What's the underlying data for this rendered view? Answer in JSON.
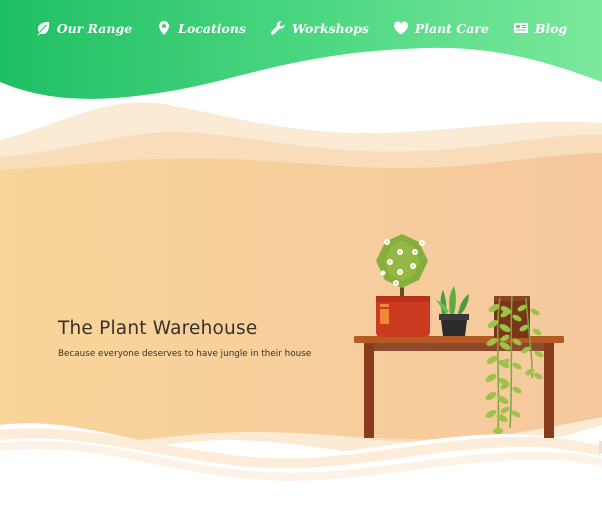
{
  "nav": {
    "items": [
      {
        "label": "Our Range",
        "icon": "leaf-icon"
      },
      {
        "label": "Locations",
        "icon": "map-pin-icon"
      },
      {
        "label": "Workshops",
        "icon": "wrench-icon"
      },
      {
        "label": "Plant Care",
        "icon": "heart-icon"
      },
      {
        "label": "Blog",
        "icon": "newspaper-icon"
      }
    ]
  },
  "hero": {
    "title": "The Plant Warehouse",
    "subtitle": "Because everyone deserves to have jungle in their house"
  },
  "colors": {
    "nav_gradient_start": "#1fbf63",
    "nav_gradient_end": "#7be89c",
    "hero_gradient_start": "#f8d59a",
    "hero_gradient_end": "#f5c89e",
    "text_dark": "#3a2f2a"
  }
}
